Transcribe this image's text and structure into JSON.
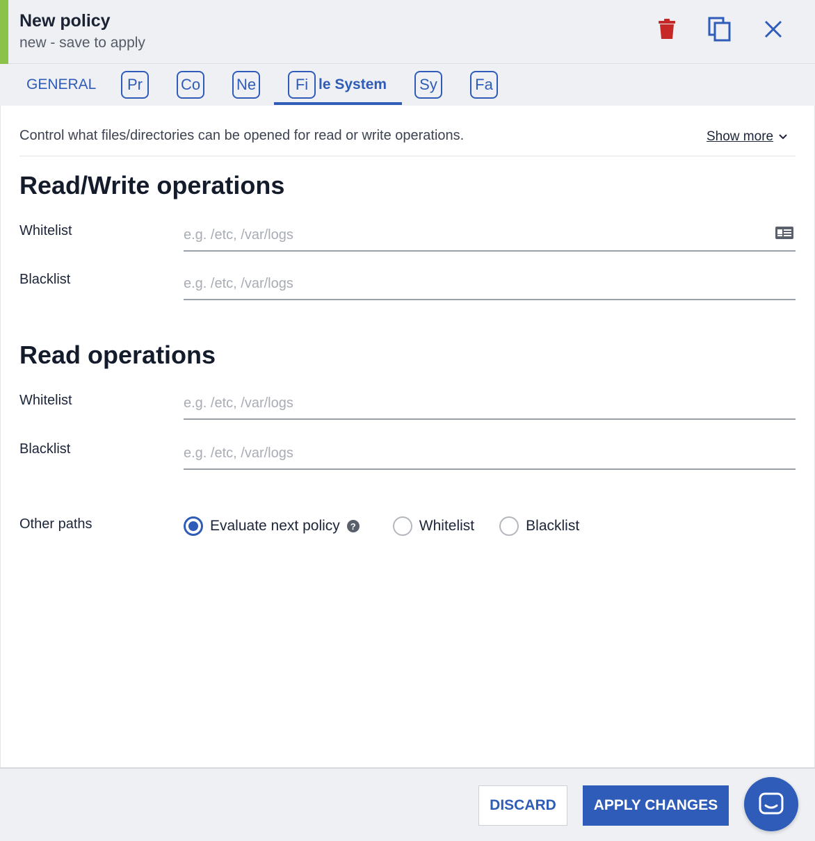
{
  "header": {
    "title": "New policy",
    "subtitle": "new - save to apply",
    "accent_color": "#8bc34a",
    "actions": [
      {
        "name": "delete",
        "icon": "trash-icon",
        "color": "#c62828"
      },
      {
        "name": "duplicate",
        "icon": "copy-icon",
        "color": "#2e5cb8"
      },
      {
        "name": "close",
        "icon": "close-icon",
        "color": "#2e5cb8"
      }
    ]
  },
  "tabs": {
    "general": "GENERAL",
    "pr": "Pr",
    "co": "Co",
    "ne": "Ne",
    "fi_pill": "Fi",
    "fi_rest": "le System",
    "sy": "Sy",
    "fa": "Fa",
    "active": "File System"
  },
  "description": "Control what files/directories can be opened for read or write operations.",
  "show_more": "Show more",
  "read_write": {
    "title": "Read/Write operations",
    "whitelist_label": "Whitelist",
    "whitelist_placeholder": "e.g. /etc, /var/logs",
    "whitelist_value": "",
    "blacklist_label": "Blacklist",
    "blacklist_placeholder": "e.g. /etc, /var/logs",
    "blacklist_value": ""
  },
  "read": {
    "title": "Read operations",
    "whitelist_label": "Whitelist",
    "whitelist_placeholder": "e.g. /etc, /var/logs",
    "whitelist_value": "",
    "blacklist_label": "Blacklist",
    "blacklist_placeholder": "e.g. /etc, /var/logs",
    "blacklist_value": ""
  },
  "other_paths": {
    "label": "Other paths",
    "options": [
      "Evaluate next policy",
      "Whitelist",
      "Blacklist"
    ],
    "selected": "Evaluate next policy"
  },
  "footer": {
    "discard": "DISCARD",
    "apply": "APPLY CHANGES"
  },
  "colors": {
    "primary": "#2e5cb8",
    "danger": "#c62828",
    "header_bg": "#eef0f3"
  }
}
